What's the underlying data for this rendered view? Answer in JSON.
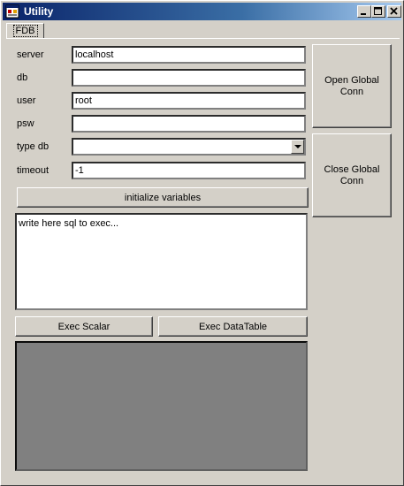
{
  "window": {
    "title": "Utility",
    "minimize": "_",
    "maximize": "□",
    "close": "×"
  },
  "tabs": [
    {
      "label": "FDB"
    }
  ],
  "form": {
    "server_label": "server",
    "server_value": "localhost",
    "db_label": "db",
    "db_value": "",
    "user_label": "user",
    "user_value": "root",
    "psw_label": "psw",
    "psw_value": "",
    "typedb_label": "type db",
    "typedb_value": "",
    "timeout_label": "timeout",
    "timeout_value": "-1"
  },
  "buttons": {
    "open_global_conn": "Open Global Conn",
    "close_global_conn": "Close Global Conn",
    "initialize_variables": "initialize variables",
    "exec_scalar": "Exec Scalar",
    "exec_datatable": "Exec DataTable"
  },
  "sql": {
    "text": "write here sql to exec..."
  }
}
